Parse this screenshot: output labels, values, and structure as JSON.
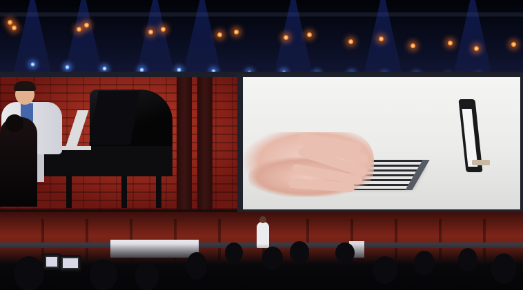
{
  "scene": {
    "colors": {
      "wall_red": "#7a1b14",
      "screen_white": "#f0f0ee",
      "truss_blue": "#0a0e22",
      "stage_light_warm": "#ff8a2a",
      "stage_light_blue": "#6fa8ff"
    },
    "icons": [
      "grand-piano",
      "keyboard-mat",
      "smartphone",
      "camera",
      "stage-light"
    ]
  }
}
